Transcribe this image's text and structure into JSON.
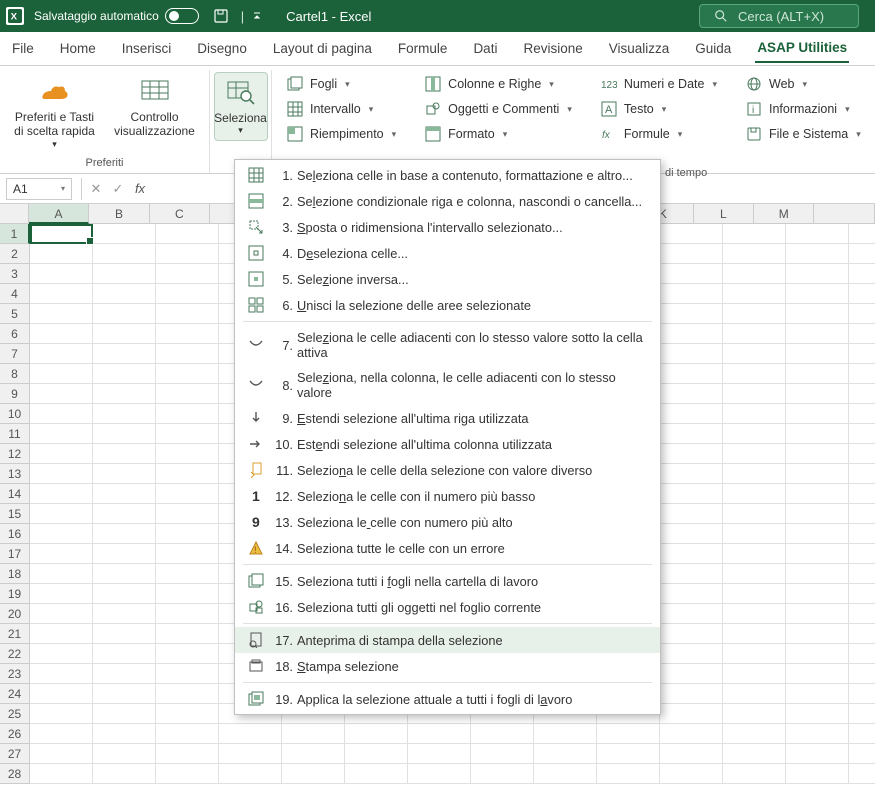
{
  "titlebar": {
    "autosave_label": "Salvataggio automatico",
    "doc_title": "Cartel1 - Excel",
    "search_placeholder": "Cerca (ALT+X)"
  },
  "tabs": {
    "items": [
      "File",
      "Home",
      "Inserisci",
      "Disegno",
      "Layout di pagina",
      "Formule",
      "Dati",
      "Revisione",
      "Visualizza",
      "Guida",
      "ASAP Utilities"
    ],
    "active_index": 10
  },
  "ribbon": {
    "preferiti": {
      "btn1": "Preferiti e Tasti di scelta rapida",
      "btn2": "Controllo visualizzazione",
      "group_label": "Preferiti"
    },
    "seleziona_btn": "Seleziona",
    "col1": {
      "fogli": "Fogli",
      "intervallo": "Intervallo",
      "riempimento": "Riempimento"
    },
    "col2": {
      "colonne": "Colonne e Righe",
      "oggetti": "Oggetti e Commenti",
      "formato": "Formato"
    },
    "col3": {
      "numeri": "Numeri e Date",
      "testo": "Testo",
      "formule": "Formule"
    },
    "col4": {
      "web": "Web",
      "informazioni": "Informazioni",
      "file": "File e Sistema"
    },
    "time_partial": "di tempo"
  },
  "formula_bar": {
    "name_box": "A1"
  },
  "grid": {
    "columns": [
      "A",
      "B",
      "C",
      "",
      "",
      "",
      "",
      "",
      "",
      "",
      "K",
      "L",
      "M",
      ""
    ],
    "row_count": 28,
    "active_cell": "A1"
  },
  "menu": {
    "items": [
      {
        "num": "1.",
        "text": "Seleziona celle in base a contenuto, formattazione e altro...",
        "u": 2
      },
      {
        "num": "2.",
        "text": "Selezione condizionale riga e colonna, nascondi o cancella...",
        "u": 2
      },
      {
        "num": "3.",
        "text": "Sposta o ridimensiona l'intervallo selezionato...",
        "u": 0
      },
      {
        "num": "4.",
        "text": "Deseleziona celle...",
        "u": 1
      },
      {
        "num": "5.",
        "text": "Selezione inversa...",
        "u": 4
      },
      {
        "num": "6.",
        "text": "Unisci la selezione delle aree selezionate",
        "u": 0
      },
      {
        "sep": true
      },
      {
        "num": "7.",
        "text": "Seleziona le celle adiacenti con lo stesso valore sotto la cella attiva",
        "u": 4
      },
      {
        "num": "8.",
        "text": "Seleziona, nella colonna, le celle adiacenti con lo stesso valore",
        "u": 4
      },
      {
        "num": "9.",
        "text": "Estendi selezione all'ultima riga utilizzata",
        "u": 0
      },
      {
        "num": "10.",
        "text": "Estendi selezione all'ultima colonna utilizzata",
        "u": 3
      },
      {
        "num": "11.",
        "text": "Seleziona le celle della selezione con valore diverso",
        "u": 7
      },
      {
        "num": "12.",
        "text": "Seleziona le celle con il numero più basso",
        "u": 7
      },
      {
        "num": "13.",
        "text": "Seleziona le celle con numero più alto",
        "u": 12
      },
      {
        "num": "14.",
        "text": "Seleziona tutte le celle con un errore",
        "u": -1
      },
      {
        "sep": true
      },
      {
        "num": "15.",
        "text": "Seleziona tutti i fogli nella cartella di lavoro",
        "u": 18
      },
      {
        "num": "16.",
        "text": "Seleziona tutti gli oggetti nel foglio corrente",
        "u": -1
      },
      {
        "sep": true
      },
      {
        "num": "17.",
        "text": "Anteprima di stampa della selezione",
        "u": -1,
        "hover": true
      },
      {
        "num": "18.",
        "text": "Stampa selezione",
        "u": 0
      },
      {
        "sep": true
      },
      {
        "num": "19.",
        "text": "Applica la selezione attuale a tutti i fogli di lavoro",
        "u": 49
      }
    ]
  }
}
